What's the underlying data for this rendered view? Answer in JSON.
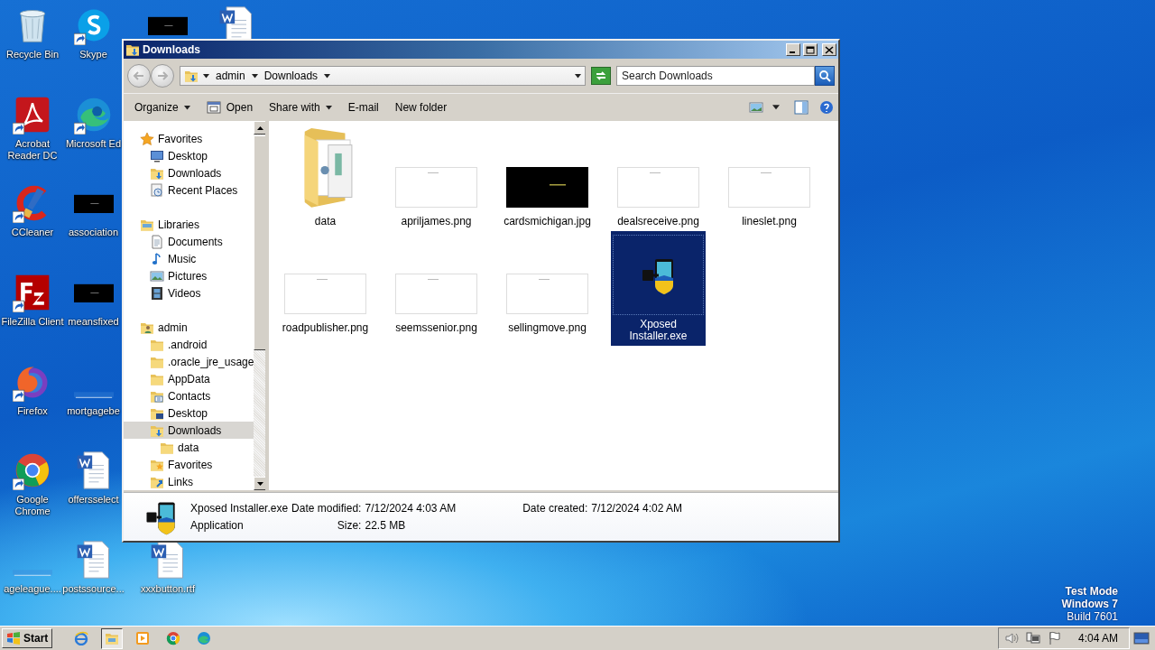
{
  "desktop": {
    "columns": [
      [
        {
          "label": "Recycle Bin",
          "kind": "recycle",
          "shortcut": false
        },
        {
          "label": "Acrobat Reader DC",
          "kind": "acrobat",
          "shortcut": true
        },
        {
          "label": "CCleaner",
          "kind": "ccleaner",
          "shortcut": true
        },
        {
          "label": "FileZilla Client",
          "kind": "filezilla",
          "shortcut": true
        },
        {
          "label": "Firefox",
          "kind": "firefox",
          "shortcut": true
        },
        {
          "label": "Google Chrome",
          "kind": "chrome",
          "shortcut": true
        },
        {
          "label": "ageleague....",
          "kind": "blank",
          "shortcut": false
        }
      ],
      [
        {
          "label": "Skype",
          "kind": "skype",
          "shortcut": true
        },
        {
          "label": "Microsoft Ed",
          "kind": "edge",
          "shortcut": true
        },
        {
          "label": "association",
          "kind": "dark",
          "shortcut": false
        },
        {
          "label": "meansfixed",
          "kind": "dark",
          "shortcut": false
        },
        {
          "label": "mortgagebe",
          "kind": "blank",
          "shortcut": false
        },
        {
          "label": "offersselect",
          "kind": "word",
          "shortcut": false
        },
        {
          "label": "postssource...",
          "kind": "word",
          "shortcut": false
        }
      ],
      [
        {
          "kind": "dark",
          "shortcut": false
        },
        {
          "label": "xxxbutton.rtf",
          "kind": "word",
          "shortcut": false
        }
      ],
      [
        {
          "kind": "word",
          "shortcut": false
        }
      ]
    ]
  },
  "window": {
    "title": "Downloads"
  },
  "address": {
    "crumbs": [
      "admin",
      "Downloads"
    ]
  },
  "search": {
    "placeholder": "Search Downloads"
  },
  "toolbar": [
    {
      "label": "Organize",
      "kind": "menu"
    },
    {
      "label": "Open",
      "kind": "open"
    },
    {
      "label": "Share with",
      "kind": "menu"
    },
    {
      "label": "E-mail",
      "kind": "action"
    },
    {
      "label": "New folder",
      "kind": "action"
    }
  ],
  "nav": [
    {
      "label": "Favorites",
      "kind": "star",
      "selected": false,
      "children": [
        {
          "label": "Desktop",
          "kind": "desktop",
          "selected": false
        },
        {
          "label": "Downloads",
          "kind": "downloads",
          "selected": false
        },
        {
          "label": "Recent Places",
          "kind": "recent",
          "selected": false
        }
      ]
    },
    {
      "label": "Libraries",
      "kind": "libraries",
      "selected": false,
      "children": [
        {
          "label": "Documents",
          "kind": "documents",
          "selected": false
        },
        {
          "label": "Music",
          "kind": "music",
          "selected": false
        },
        {
          "label": "Pictures",
          "kind": "pictures",
          "selected": false
        },
        {
          "label": "Videos",
          "kind": "videos",
          "selected": false
        }
      ]
    },
    {
      "label": "admin",
      "kind": "user",
      "selected": false,
      "children": [
        {
          "label": ".android",
          "kind": "folder",
          "selected": false
        },
        {
          "label": ".oracle_jre_usage",
          "kind": "folder",
          "selected": false
        },
        {
          "label": "AppData",
          "kind": "folder",
          "selected": false
        },
        {
          "label": "Contacts",
          "kind": "contacts",
          "selected": false
        },
        {
          "label": "Desktop",
          "kind": "desktop-folder",
          "selected": false
        },
        {
          "label": "Downloads",
          "kind": "downloads",
          "selected": true,
          "children": [
            {
              "label": "data",
              "kind": "folder",
              "selected": false
            }
          ]
        },
        {
          "label": "Favorites",
          "kind": "favorites",
          "selected": false
        },
        {
          "label": "Links",
          "kind": "links",
          "selected": false
        }
      ]
    }
  ],
  "files": [
    {
      "name": "data",
      "kind": "folder",
      "selected": false
    },
    {
      "name": "apriljames.png",
      "kind": "image-light",
      "selected": false
    },
    {
      "name": "cardsmichigan.jpg",
      "kind": "image-dark",
      "selected": false
    },
    {
      "name": "dealsreceive.png",
      "kind": "image-light",
      "selected": false
    },
    {
      "name": "lineslet.png",
      "kind": "image-light",
      "selected": false
    },
    {
      "name": "roadpublisher.png",
      "kind": "image-light",
      "selected": false
    },
    {
      "name": "seemssenior.png",
      "kind": "image-light",
      "selected": false
    },
    {
      "name": "sellingmove.png",
      "kind": "image-light",
      "selected": false
    },
    {
      "name": "Xposed Installer.exe",
      "kind": "exe",
      "selected": true
    }
  ],
  "details": {
    "name": "Xposed Installer.exe",
    "type": "Application",
    "modified_label": "Date modified:",
    "modified": "7/12/2024 4:03 AM",
    "created_label": "Date created:",
    "created": "7/12/2024 4:02 AM",
    "size_label": "Size:",
    "size": "22.5 MB"
  },
  "os_notice": {
    "lines": [
      "Test Mode",
      "Windows 7",
      "Build 7601"
    ]
  },
  "taskbar": {
    "start": "Start",
    "apps": [
      {
        "kind": "ie",
        "selected": false
      },
      {
        "kind": "explorer",
        "selected": true
      },
      {
        "kind": "media",
        "selected": false
      },
      {
        "kind": "chrome",
        "selected": false
      },
      {
        "kind": "edge",
        "selected": false
      }
    ],
    "time": "4:04 AM"
  }
}
